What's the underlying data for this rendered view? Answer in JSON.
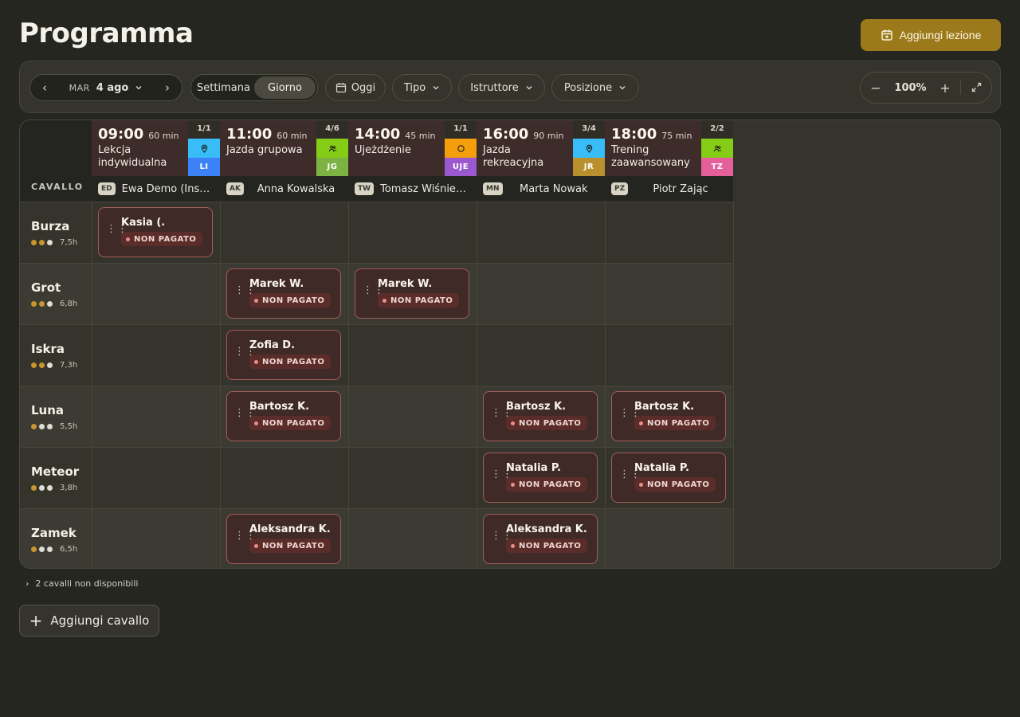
{
  "page": {
    "title": "Programma",
    "add_lesson_label": "Aggiungi lezione"
  },
  "toolbar": {
    "dow": "MAR",
    "date": "4 ago",
    "views": [
      "Settimana",
      "Giorno"
    ],
    "active_view": "Giorno",
    "today_label": "Oggi",
    "filters": [
      "Tipo",
      "Istruttore",
      "Posizione"
    ],
    "zoom": "100%"
  },
  "grid": {
    "corner_label": "CAVALLO",
    "lessons": [
      {
        "time": "09:00",
        "duration": "60 min",
        "name": "Lekcja indywidualna",
        "count": "1/1",
        "tag_icon": "location-pin-icon",
        "tag_color": "#38bdf8",
        "code": "LI",
        "code_color": "#3b82f6",
        "instructor_initials": "ED",
        "instructor": "Ewa Demo (Instruktor)"
      },
      {
        "time": "11:00",
        "duration": "60 min",
        "name": "Jazda grupowa",
        "count": "4/6",
        "tag_icon": "group-icon",
        "tag_color": "#84cc16",
        "code": "JG",
        "code_color": "#7cb342",
        "instructor_initials": "AK",
        "instructor": "Anna Kowalska"
      },
      {
        "time": "14:00",
        "duration": "45 min",
        "name": "Ujeżdżenie",
        "count": "1/1",
        "tag_icon": "circle-icon",
        "tag_color": "#f59e0b",
        "code": "UJE",
        "code_color": "#9b59d0",
        "instructor_initials": "TW",
        "instructor": "Tomasz Wiśniewski"
      },
      {
        "time": "16:00",
        "duration": "90 min",
        "name": "Jazda rekreacyjna",
        "count": "3/4",
        "tag_icon": "location-pin-icon",
        "tag_color": "#38bdf8",
        "code": "JR",
        "code_color": "#b8902e",
        "instructor_initials": "MN",
        "instructor": "Marta Nowak"
      },
      {
        "time": "18:00",
        "duration": "75 min",
        "name": "Trening zaawansowany",
        "count": "2/2",
        "tag_icon": "group-icon",
        "tag_color": "#84cc16",
        "code": "TZ",
        "code_color": "#e5609a",
        "instructor_initials": "PZ",
        "instructor": "Piotr Zając"
      }
    ],
    "horses": [
      {
        "name": "Burza",
        "level": 3,
        "hours": "7,5h"
      },
      {
        "name": "Grot",
        "level": 3,
        "hours": "6,8h"
      },
      {
        "name": "Iskra",
        "level": 3,
        "hours": "7,3h"
      },
      {
        "name": "Luna",
        "level": 2,
        "hours": "5,5h"
      },
      {
        "name": "Meteor",
        "level": 2,
        "hours": "3,8h"
      },
      {
        "name": "Zamek",
        "level": 2,
        "hours": "6,5h"
      }
    ],
    "assignments": [
      {
        "horse": 0,
        "lesson": 0,
        "rider": "Kasia (.",
        "status": "NON PAGATO"
      },
      {
        "horse": 1,
        "lesson": 1,
        "rider": "Marek W.",
        "status": "NON PAGATO"
      },
      {
        "horse": 1,
        "lesson": 2,
        "rider": "Marek W.",
        "status": "NON PAGATO"
      },
      {
        "horse": 2,
        "lesson": 1,
        "rider": "Zofia D.",
        "status": "NON PAGATO"
      },
      {
        "horse": 3,
        "lesson": 1,
        "rider": "Bartosz K.",
        "status": "NON PAGATO"
      },
      {
        "horse": 3,
        "lesson": 3,
        "rider": "Bartosz K.",
        "status": "NON PAGATO"
      },
      {
        "horse": 3,
        "lesson": 4,
        "rider": "Bartosz K.",
        "status": "NON PAGATO"
      },
      {
        "horse": 4,
        "lesson": 3,
        "rider": "Natalia P.",
        "status": "NON PAGATO"
      },
      {
        "horse": 4,
        "lesson": 4,
        "rider": "Natalia P.",
        "status": "NON PAGATO"
      },
      {
        "horse": 5,
        "lesson": 1,
        "rider": "Aleksandra K.",
        "status": "NON PAGATO"
      },
      {
        "horse": 5,
        "lesson": 3,
        "rider": "Aleksandra K.",
        "status": "NON PAGATO"
      }
    ]
  },
  "footer": {
    "unavailable": "2 cavalli non disponibili",
    "add_horse": "Aggiungi cavallo"
  },
  "colors": {
    "accent": "#9c7a1c",
    "unpaid_border": "#a35d55",
    "level_on": "#c9952e",
    "level_off": "#6b6b60",
    "level_light": "#e0ddd2"
  }
}
